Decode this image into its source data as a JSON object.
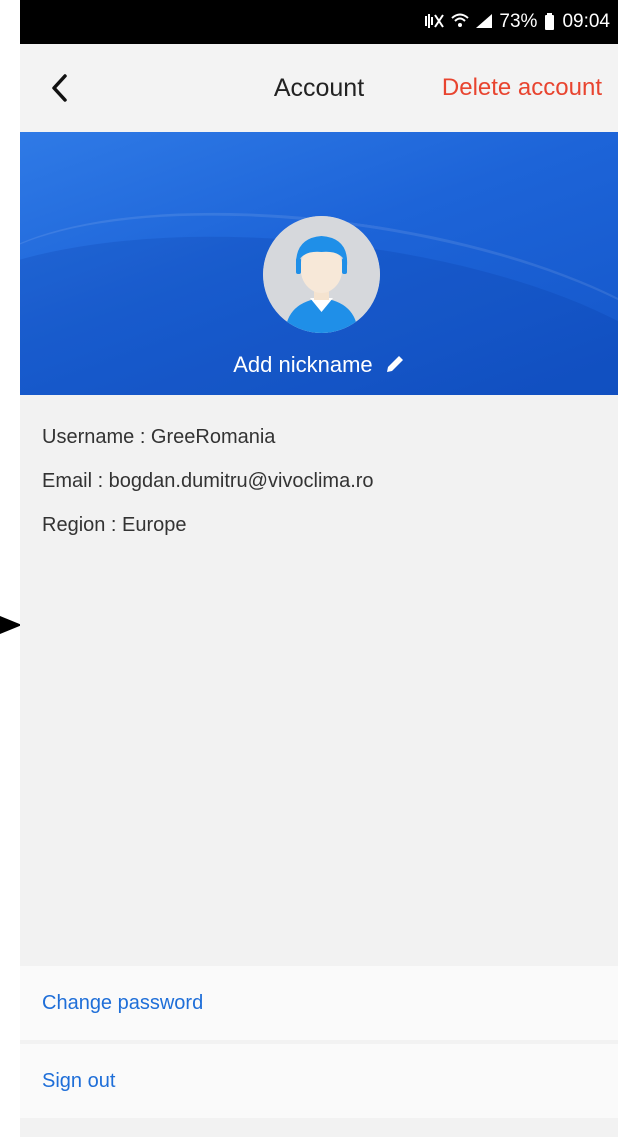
{
  "status_bar": {
    "battery": "73%",
    "time": "09:04",
    "icons": [
      "mute-vibrate-icon",
      "wifi-icon",
      "signal-icon",
      "battery-icon"
    ]
  },
  "nav": {
    "back_icon": "chevron-left-icon",
    "title": "Account",
    "delete_label": "Delete account",
    "delete_color": "#e8442f"
  },
  "profile": {
    "nickname_label": "Add nickname",
    "avatar_icon": "user-avatar-icon",
    "edit_icon": "pencil-icon",
    "banner_color": "#1d64d8"
  },
  "info": {
    "username": "Username : GreeRomania",
    "email": "Email : bogdan.dumitru@vivoclima.ro",
    "region": "Region : Europe"
  },
  "actions": {
    "change_password": "Change password",
    "sign_out": "Sign out",
    "link_color": "#1e6ed8"
  }
}
